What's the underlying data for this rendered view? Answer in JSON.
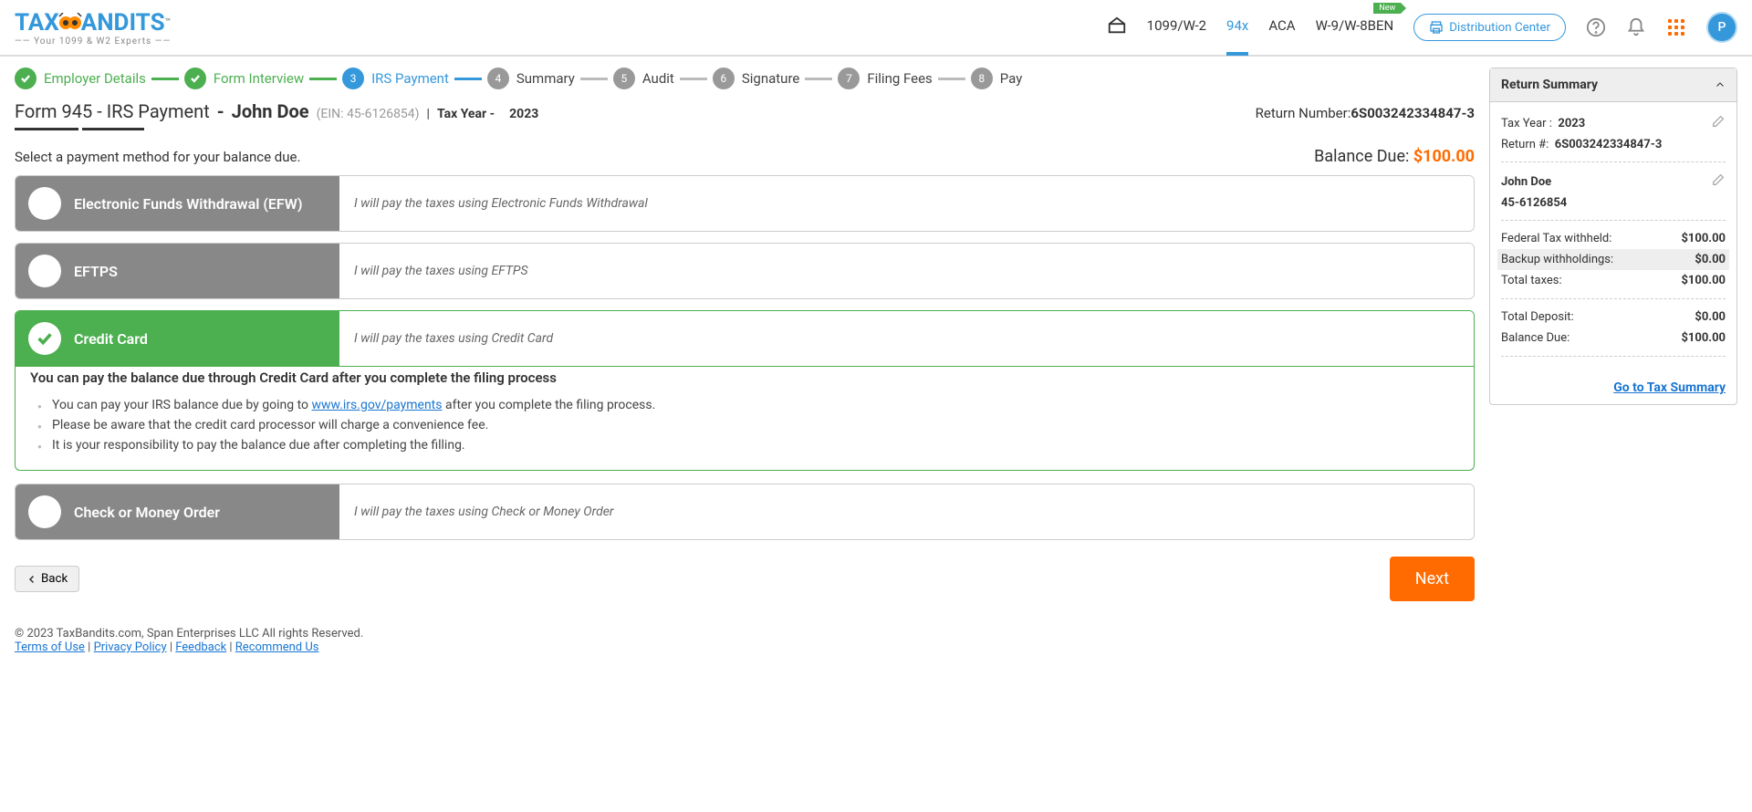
{
  "logo": {
    "main": "TAX",
    "main2": "ANDITS",
    "tm": "™",
    "sub": "Your 1099 & W2 Experts"
  },
  "nav": {
    "items": [
      "1099/W-2",
      "94x",
      "ACA",
      "W-9/W-8BEN"
    ],
    "active_index": 1,
    "new_badge": "New",
    "dist_center": "Distribution Center",
    "avatar": "P"
  },
  "stepper": [
    {
      "label": "Employer Details",
      "state": "done"
    },
    {
      "label": "Form Interview",
      "state": "done"
    },
    {
      "num": "3",
      "label": "IRS Payment",
      "state": "active"
    },
    {
      "num": "4",
      "label": "Summary",
      "state": "pending"
    },
    {
      "num": "5",
      "label": "Audit",
      "state": "pending"
    },
    {
      "num": "6",
      "label": "Signature",
      "state": "pending"
    },
    {
      "num": "7",
      "label": "Filing Fees",
      "state": "pending"
    },
    {
      "num": "8",
      "label": "Pay",
      "state": "pending"
    }
  ],
  "page": {
    "title": "Form 945 - IRS Payment",
    "name_prefix": "-",
    "name": "John Doe",
    "ein": "(EIN: 45-6126854)",
    "ty_label": "Tax Year -",
    "ty_value": "2023",
    "return_label": "Return Number:",
    "return_value": "6S003242334847-3",
    "prompt": "Select a payment method for your balance due.",
    "balance_label": "Balance Due:",
    "balance_amt": "$100.00"
  },
  "options": [
    {
      "title": "Electronic Funds Withdrawal (EFW)",
      "desc": "I will pay the taxes using Electronic Funds Withdrawal"
    },
    {
      "title": "EFTPS",
      "desc": "I will pay the taxes using EFTPS"
    },
    {
      "title": "Credit Card",
      "desc": "I will pay the taxes using Credit Card"
    },
    {
      "title": "Check or Money Order",
      "desc": "I will pay the taxes using Check or Money Order"
    }
  ],
  "cc_info": {
    "heading": "You can pay the balance due through Credit Card after you complete the filing process",
    "b1a": "You can pay your IRS balance due by going to ",
    "b1_link": "www.irs.gov/payments",
    "b1b": " after you complete the filing process.",
    "b2": "Please be aware that the credit card processor will charge a convenience fee.",
    "b3": "It is your responsibility to pay the balance due after completing the filling."
  },
  "actions": {
    "back": "Back",
    "next": "Next"
  },
  "summary": {
    "title": "Return Summary",
    "ty_label": "Tax Year :",
    "ty_value": "2023",
    "rn_label": "Return #:",
    "rn_value": "6S003242334847-3",
    "name": "John Doe",
    "ein": "45-6126854",
    "rows": [
      {
        "label": "Federal Tax withheld:",
        "value": "$100.00"
      },
      {
        "label": "Backup withholdings:",
        "value": "$0.00",
        "shade": true
      },
      {
        "label": "Total taxes:",
        "value": "$100.00"
      }
    ],
    "rows2": [
      {
        "label": "Total Deposit:",
        "value": "$0.00"
      },
      {
        "label": "Balance Due:",
        "value": "$100.00"
      }
    ],
    "link": "Go to Tax Summary"
  },
  "footer": {
    "copyright": "© 2023 TaxBandits.com, Span Enterprises LLC All rights Reserved.",
    "links": [
      "Terms of Use",
      "Privacy Policy",
      "Feedback",
      "Recommend Us"
    ]
  }
}
